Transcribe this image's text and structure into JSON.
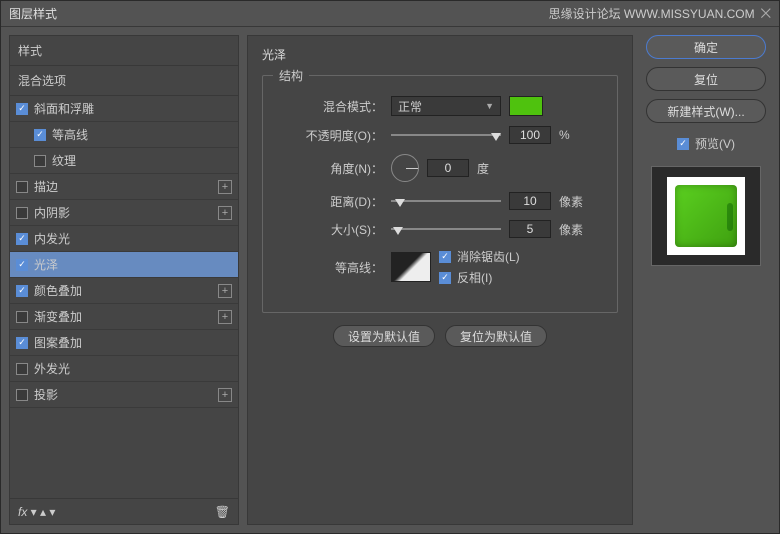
{
  "titlebar": {
    "title": "图层样式",
    "watermark": "思缘设计论坛  WWW.MISSYUAN.COM"
  },
  "sidebar": {
    "styles_header": "样式",
    "blending_header": "混合选项",
    "items": [
      {
        "label": "斜面和浮雕",
        "checked": true,
        "plus": false,
        "child": false
      },
      {
        "label": "等高线",
        "checked": true,
        "plus": false,
        "child": true
      },
      {
        "label": "纹理",
        "checked": false,
        "plus": false,
        "child": true
      },
      {
        "label": "描边",
        "checked": false,
        "plus": true,
        "child": false
      },
      {
        "label": "内阴影",
        "checked": false,
        "plus": true,
        "child": false
      },
      {
        "label": "内发光",
        "checked": true,
        "plus": false,
        "child": false
      },
      {
        "label": "光泽",
        "checked": true,
        "plus": false,
        "child": false,
        "selected": true
      },
      {
        "label": "颜色叠加",
        "checked": true,
        "plus": true,
        "child": false
      },
      {
        "label": "渐变叠加",
        "checked": false,
        "plus": true,
        "child": false
      },
      {
        "label": "图案叠加",
        "checked": true,
        "plus": false,
        "child": false
      },
      {
        "label": "外发光",
        "checked": false,
        "plus": false,
        "child": false
      },
      {
        "label": "投影",
        "checked": false,
        "plus": true,
        "child": false
      }
    ],
    "footer_fx": "fx"
  },
  "center": {
    "panel_title": "光泽",
    "group_title": "结构",
    "blend_label": "混合模式：",
    "blend_value": "正常",
    "color": "#4fc20e",
    "opacity_label": "不透明度(O)：",
    "opacity_value": "100",
    "opacity_unit": "%",
    "angle_label": "角度(N)：",
    "angle_value": "0",
    "angle_unit": "度",
    "distance_label": "距离(D)：",
    "distance_value": "10",
    "distance_unit": "像素",
    "size_label": "大小(S)：",
    "size_value": "5",
    "size_unit": "像素",
    "contour_label": "等高线：",
    "antialias_label": "消除锯齿(L)",
    "invert_label": "反相(I)",
    "make_default": "设置为默认值",
    "reset_default": "复位为默认值"
  },
  "right": {
    "ok": "确定",
    "cancel": "复位",
    "new_style": "新建样式(W)...",
    "preview_label": "预览(V)"
  }
}
